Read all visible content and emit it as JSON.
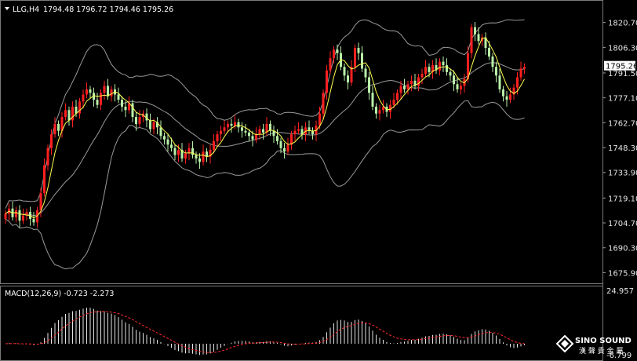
{
  "header": {
    "symbol": "LLG,H4",
    "ohlc_text": "1794.48 1796.72 1794.46 1795.26"
  },
  "macd": {
    "label": "MACD(12,26,9) -0.723 -2.273",
    "top_value": "24.957",
    "bottom_value": "-6.799"
  },
  "watermark": {
    "brand": "SINO SOUND",
    "sub": "漢 聲 貴 金 屬"
  },
  "colors": {
    "background": "#000000",
    "bull_candle": "#ff2020",
    "bear_candle": "#b8f0a8",
    "band": "#9a9a9a",
    "ma": "#ffff50",
    "macd_hist": "#e6e6e6",
    "macd_signal": "#ff2a2a",
    "current_price_bg": "#ffffff"
  },
  "chart_data": [
    {
      "type": "candlestick",
      "symbol": "LLG",
      "timeframe": "H4",
      "ylim": [
        1672.0,
        1831.0
      ],
      "y_ticks": [
        "1820.70",
        "1806.30",
        "1791.50",
        "1777.10",
        "1762.70",
        "1748.30",
        "1733.90",
        "1719.10",
        "1704.70",
        "1690.30",
        "1675.90"
      ],
      "current_price": "1795.26",
      "overlays": [
        "Bollinger Bands (upper/middle/lower)",
        "Moving average"
      ],
      "close": [
        1710,
        1713,
        1708,
        1712,
        1706,
        1709,
        1711,
        1707,
        1705,
        1712,
        1722,
        1738,
        1748,
        1756,
        1762,
        1758,
        1766,
        1770,
        1764,
        1772,
        1768,
        1775,
        1779,
        1782,
        1780,
        1776,
        1773,
        1780,
        1784,
        1778,
        1782,
        1779,
        1776,
        1772,
        1770,
        1774,
        1766,
        1762,
        1766,
        1768,
        1764,
        1759,
        1763,
        1760,
        1755,
        1753,
        1750,
        1748,
        1744,
        1747,
        1742,
        1745,
        1748,
        1744,
        1742,
        1740,
        1746,
        1743,
        1747,
        1752,
        1756,
        1758,
        1760,
        1762,
        1761,
        1763,
        1760,
        1758,
        1757,
        1755,
        1753,
        1756,
        1759,
        1757,
        1762,
        1758,
        1755,
        1752,
        1748,
        1746,
        1750,
        1756,
        1758,
        1759,
        1756,
        1760,
        1758,
        1756,
        1761,
        1768,
        1780,
        1793,
        1800,
        1805,
        1803,
        1795,
        1790,
        1786,
        1795,
        1806,
        1803,
        1794,
        1789,
        1780,
        1772,
        1768,
        1770,
        1772,
        1769,
        1773,
        1776,
        1780,
        1784,
        1782,
        1785,
        1787,
        1784,
        1789,
        1791,
        1795,
        1792,
        1796,
        1793,
        1798,
        1796,
        1792,
        1790,
        1785,
        1782,
        1784,
        1788,
        1803,
        1818,
        1814,
        1810,
        1812,
        1806,
        1801,
        1795,
        1790,
        1782,
        1778,
        1776,
        1779,
        1783,
        1789,
        1794,
        1795
      ],
      "macd_hist_range": [
        -6.799,
        24.957
      ]
    }
  ]
}
